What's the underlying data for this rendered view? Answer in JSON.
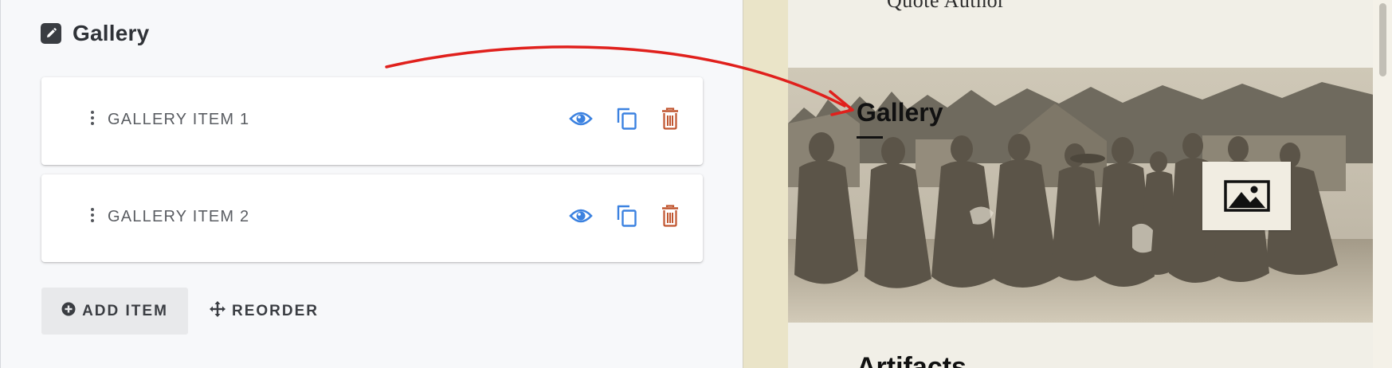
{
  "editor": {
    "section_title": "Gallery",
    "items": [
      {
        "label": "GALLERY ITEM 1"
      },
      {
        "label": "GALLERY ITEM 2"
      }
    ],
    "add_label": "ADD ITEM",
    "reorder_label": "REORDER",
    "colors": {
      "eye": "#3c82e0",
      "copy": "#3c82e0",
      "trash": "#c0552f",
      "annotation": "#e0201c"
    }
  },
  "preview": {
    "quote_author": "Quote Author",
    "hero_title": "Gallery",
    "next_section_title": "Artifacts"
  }
}
